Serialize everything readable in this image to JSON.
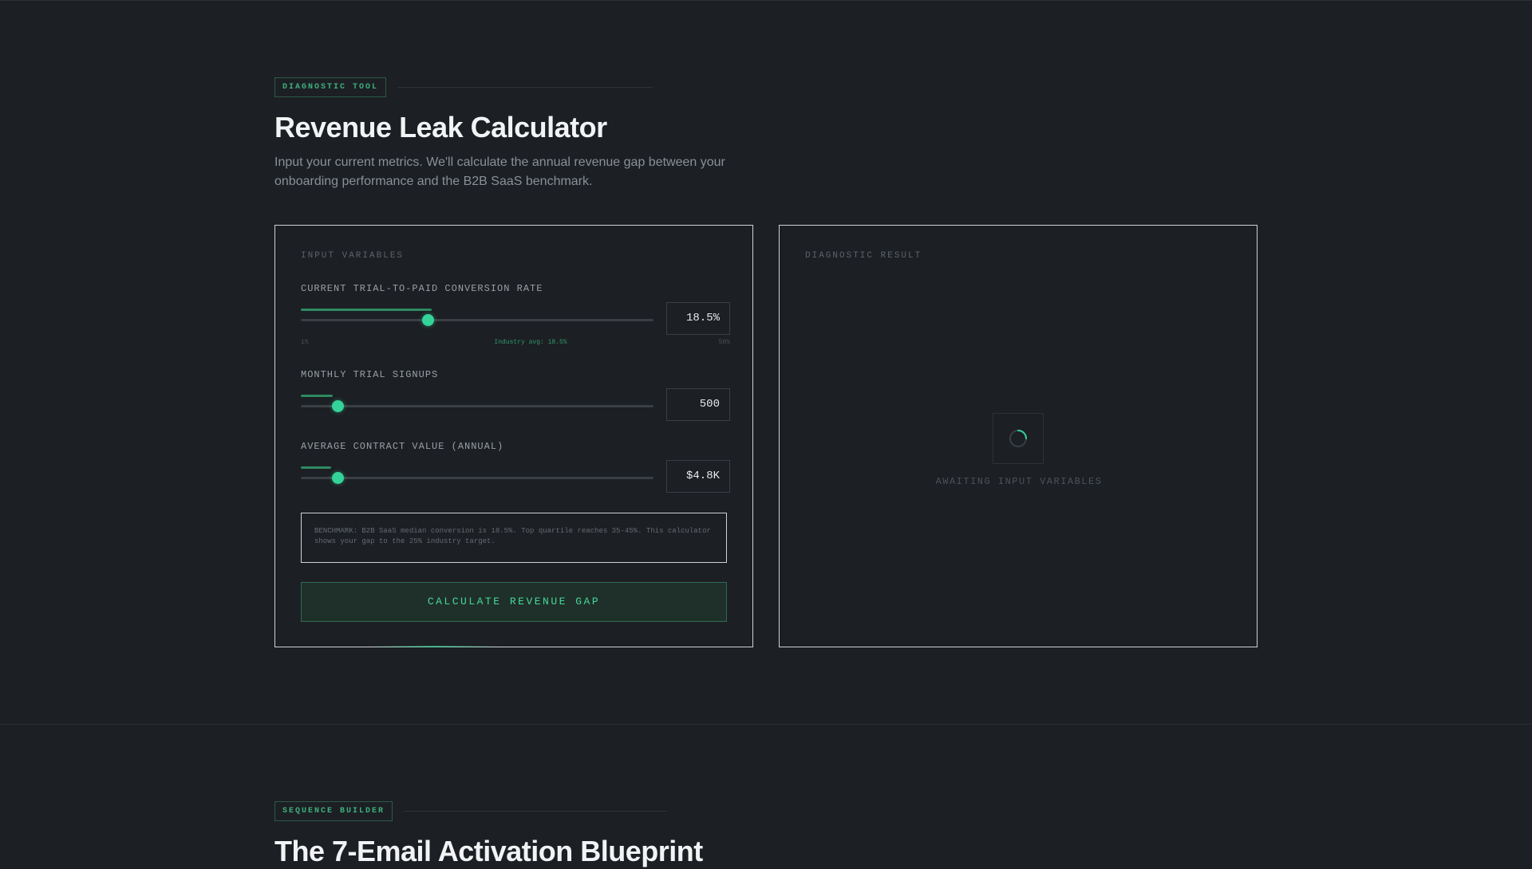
{
  "section1": {
    "tag": "DIAGNOSTIC TOOL",
    "title": "Revenue Leak Calculator",
    "description": "Input your current metrics. We'll calculate the annual revenue gap between your onboarding performance and the B2B SaaS benchmark."
  },
  "input_panel": {
    "label": "INPUT VARIABLES",
    "conversion": {
      "label": "CURRENT TRIAL-TO-PAID CONVERSION RATE",
      "value": "18.5%",
      "min_label": "1%",
      "max_label": "50%",
      "avg_label": "Industry avg: 18.5%",
      "slider_fraction": 0.36
    },
    "signups": {
      "label": "MONTHLY TRIAL SIGNUPS",
      "value": "500",
      "slider_fraction": 0.1
    },
    "acv": {
      "label": "AVERAGE CONTRACT VALUE (ANNUAL)",
      "value": "$4.8K",
      "slider_fraction": 0.1
    },
    "benchmark_note": "BENCHMARK: B2B SaaS median conversion is 18.5%. Top quartile reaches 35-45%. This calculator shows your gap to the 25% industry target.",
    "button_label": "CALCULATE REVENUE GAP"
  },
  "result_panel": {
    "label": "DIAGNOSTIC RESULT",
    "awaiting": "AWAITING INPUT VARIABLES"
  },
  "section2": {
    "tag": "SEQUENCE BUILDER",
    "title": "The 7-Email Activation Blueprint"
  },
  "colors": {
    "background": "#1c1f23",
    "accent": "#34d399",
    "accent_muted": "#2e8a62"
  }
}
